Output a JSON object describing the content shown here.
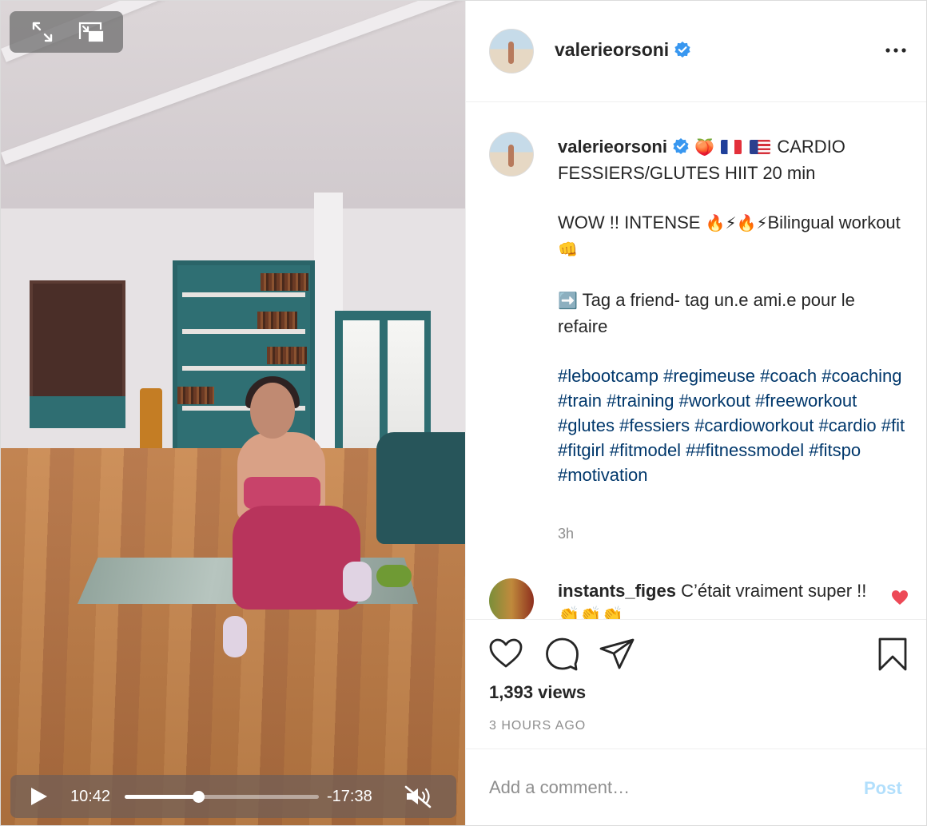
{
  "video": {
    "current_time": "10:42",
    "remaining_time": "-17:38",
    "progress": 0.38,
    "muted": true
  },
  "post": {
    "username": "valerieorsoni",
    "verified": true,
    "caption": {
      "line1": "CARDIO FESSIERS/GLUTES HIIT 20 min",
      "line2_text": "WOW !! INTENSE",
      "line2_tail": "Bilingual workout",
      "line3": "Tag a friend- tag un.e ami.e pour le refaire",
      "hashtags": "#lebootcamp #regimeuse #coach #coaching #train #training #workout #freeworkout #glutes #fessiers #cardioworkout #cardio #fit #fitgirl #fitmodel ##fitnessmodel #fitspo #motivation"
    },
    "caption_time": "3h",
    "comment": {
      "username": "instants_figes",
      "text": "C’était vraiment super !! 👏👏👏"
    },
    "views": "1,393 views",
    "posted_ago": "3 HOURS AGO"
  },
  "add_comment": {
    "placeholder": "Add a comment…",
    "post_label": "Post"
  },
  "colors": {
    "hashtag": "#00376b",
    "verified": "#3897f0",
    "liked": "#ed4956",
    "post_disabled": "#b2dffc"
  }
}
